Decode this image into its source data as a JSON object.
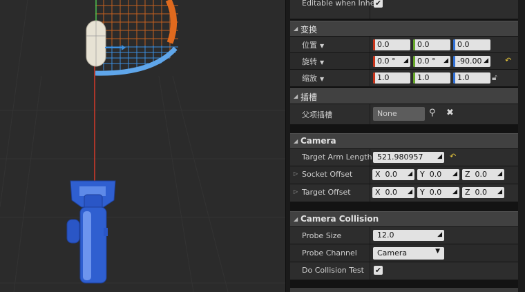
{
  "top_row": {
    "label": "Editable when Inher",
    "checked": true
  },
  "transform": {
    "title": "变换",
    "location": {
      "label": "位置",
      "x": "0.0",
      "y": "0.0",
      "z": "0.0"
    },
    "rotation": {
      "label": "旋转",
      "x": "0.0 °",
      "y": "0.0 °",
      "z": "-90.00"
    },
    "scale": {
      "label": "缩放",
      "x": "1.0",
      "y": "1.0",
      "z": "1.0"
    }
  },
  "sockets": {
    "title": "插槽",
    "parent_socket": {
      "label": "父项插槽",
      "value": "None"
    }
  },
  "camera": {
    "title": "Camera",
    "target_arm_length": {
      "label": "Target Arm Length",
      "value": "521.980957"
    },
    "socket_offset": {
      "label": "Socket Offset",
      "x_label": "X",
      "x": "0.0",
      "y_label": "Y",
      "y": "0.0",
      "z_label": "Z",
      "z": "0.0"
    },
    "target_offset": {
      "label": "Target Offset",
      "x_label": "X",
      "x": "0.0",
      "y_label": "Y",
      "y": "0.0",
      "z_label": "Z",
      "z": "0.0"
    }
  },
  "camera_collision": {
    "title": "Camera Collision",
    "probe_size": {
      "label": "Probe Size",
      "value": "12.0"
    },
    "probe_channel": {
      "label": "Probe Channel",
      "value": "Camera"
    },
    "do_collision_test": {
      "label": "Do Collision Test",
      "checked": true
    }
  },
  "icons": {
    "reset": "reset-to-default-icon",
    "lock": "lock-icon",
    "browse": "search-icon",
    "clear": "close-icon"
  },
  "colors": {
    "axis_x": "#c8331a",
    "axis_y": "#66a629",
    "axis_z": "#2f6fd6",
    "reset": "#e1c23b",
    "viewport_bg": "#2b2b2b",
    "panel_bg": "#2d2d2d",
    "category_bg": "#414141",
    "mannequin": "#2f5fd0",
    "arc_orange": "#e06a1e",
    "arc_blue": "#3b8fe0"
  }
}
